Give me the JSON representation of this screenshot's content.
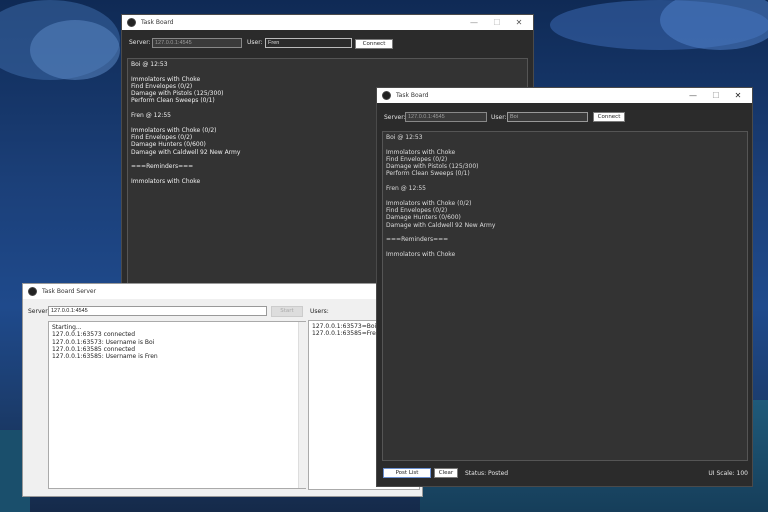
{
  "back_window": {
    "title": "Task Board",
    "server_label": "Server:",
    "server_value": "127.0.0.1:4545",
    "user_label": "User:",
    "user_value": "Fren",
    "connect_label": "Connect",
    "lines": [
      "Boi @ 12:53",
      "",
      "Immolators with Choke",
      "Find Envelopes (0/2)",
      "Damage with Pistols (125/300)",
      "Perform Clean Sweeps (0/1)",
      "",
      "Fren @ 12:55",
      "",
      "Immolators with Choke (0/2)",
      "Find Envelopes (0/2)",
      "Damage Hunters (0/600)",
      "Damage with Caldwell 92 New Army",
      "",
      "===Reminders===",
      "",
      "Immolators with Choke"
    ]
  },
  "front_window": {
    "title": "Task Board",
    "server_label": "Server:",
    "server_value": "127.0.0.1:4545",
    "user_label": "User:",
    "user_value": "Boi",
    "connect_label": "Connect",
    "lines": [
      "Boi @ 12:53",
      "",
      "Immolators with Choke",
      "Find Envelopes (0/2)",
      "Damage with Pistols (125/300)",
      "Perform Clean Sweeps (0/1)",
      "",
      "Fren @ 12:55",
      "",
      "Immolators with Choke (0/2)",
      "Find Envelopes (0/2)",
      "Damage Hunters (0/600)",
      "Damage with Caldwell 92 New Army",
      "",
      "===Reminders===",
      "",
      "Immolators with Choke"
    ],
    "post_label": "Post List",
    "clear_label": "Clear",
    "status_text": "Status: Posted",
    "ui_scale_text": "UI Scale: 100"
  },
  "server_window": {
    "title": "Task Board Server",
    "server_label": "Server:",
    "server_value": "127.0.0.1:4545",
    "start_label": "Start",
    "users_label": "Users:",
    "log_lines": [
      "Starting...",
      "127.0.0.1:63573 connected",
      "127.0.0.1:63573: Username is Boi",
      "127.0.0.1:63585 connected",
      "127.0.0.1:63585: Username is Fren"
    ],
    "users": [
      "127.0.0.1:63573=Boi",
      "127.0.0.1:63585=Fren"
    ]
  },
  "window_controls": {
    "minimize": "—",
    "maximize": "☐",
    "close": "✕"
  }
}
